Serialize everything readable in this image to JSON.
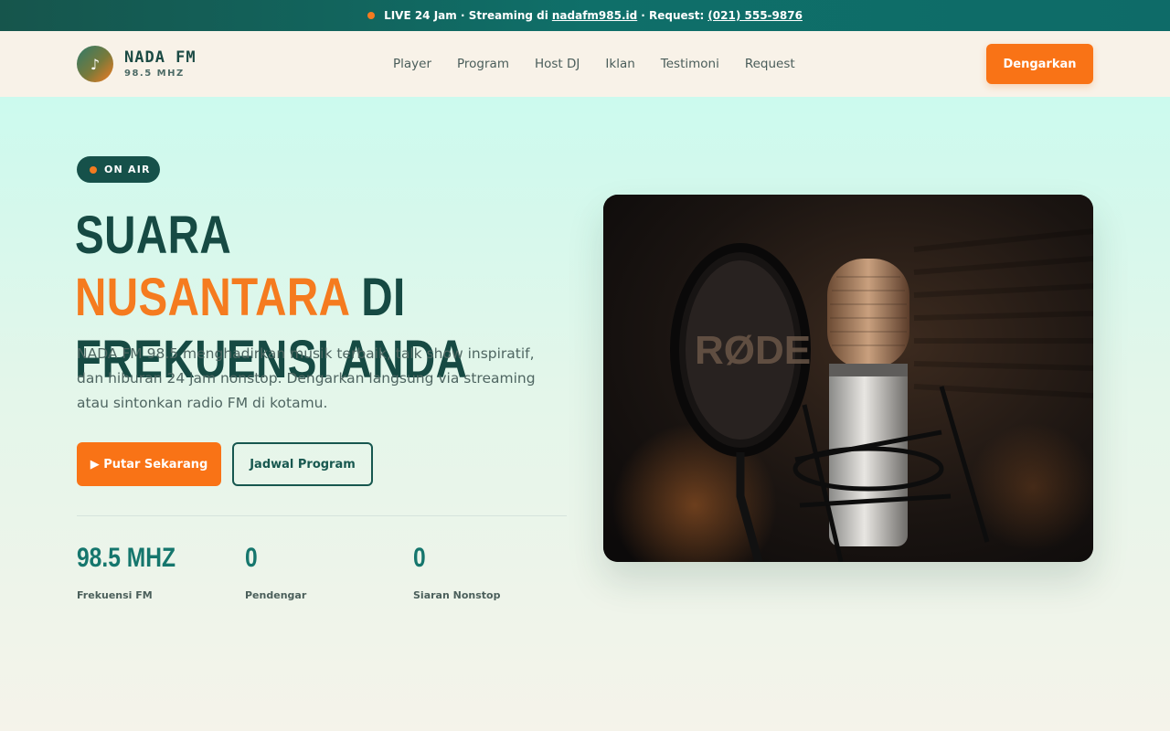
{
  "topbar": {
    "text_before": "LIVE 24 Jam · Streaming di",
    "link_site": "nadafm985.id",
    "text_middle": "· Request:",
    "link_phone": "(021) 555-9876"
  },
  "header": {
    "logo_name": "NADA FM",
    "logo_freq": "98.5 MHZ",
    "nav": [
      "Player",
      "Program",
      "Host DJ",
      "Iklan",
      "Testimoni",
      "Request"
    ],
    "cta_label": "Dengarkan"
  },
  "hero": {
    "badge": "ON AIR",
    "headline_part1": "SUARA ",
    "headline_accent": "NUSANTARA",
    "headline_part2": " DI FREKUENSI ANDA",
    "lead": "NADA FM 98.5 menghadirkan musik terbaik, talk show inspiratif, dan hiburan 24 jam nonstop. Dengarkan langsung via streaming atau sintonkan radio FM di kotamu.",
    "primary_button": "▶ Putar Sekarang",
    "secondary_button": "Jadwal Program",
    "stats": [
      {
        "value": "98.5 MHZ",
        "label": "Frekuensi FM"
      },
      {
        "value": "0",
        "label": "Pendengar"
      },
      {
        "value": "0",
        "label": "Siaran Nonstop"
      }
    ],
    "photo_mic_brand": "RØDE"
  },
  "colors": {
    "accent": "#f97316",
    "brand_dark": "#164a43",
    "teal": "#15766d"
  },
  "icons": {
    "logo": "music-note-icon",
    "live": "live-dot-icon"
  }
}
